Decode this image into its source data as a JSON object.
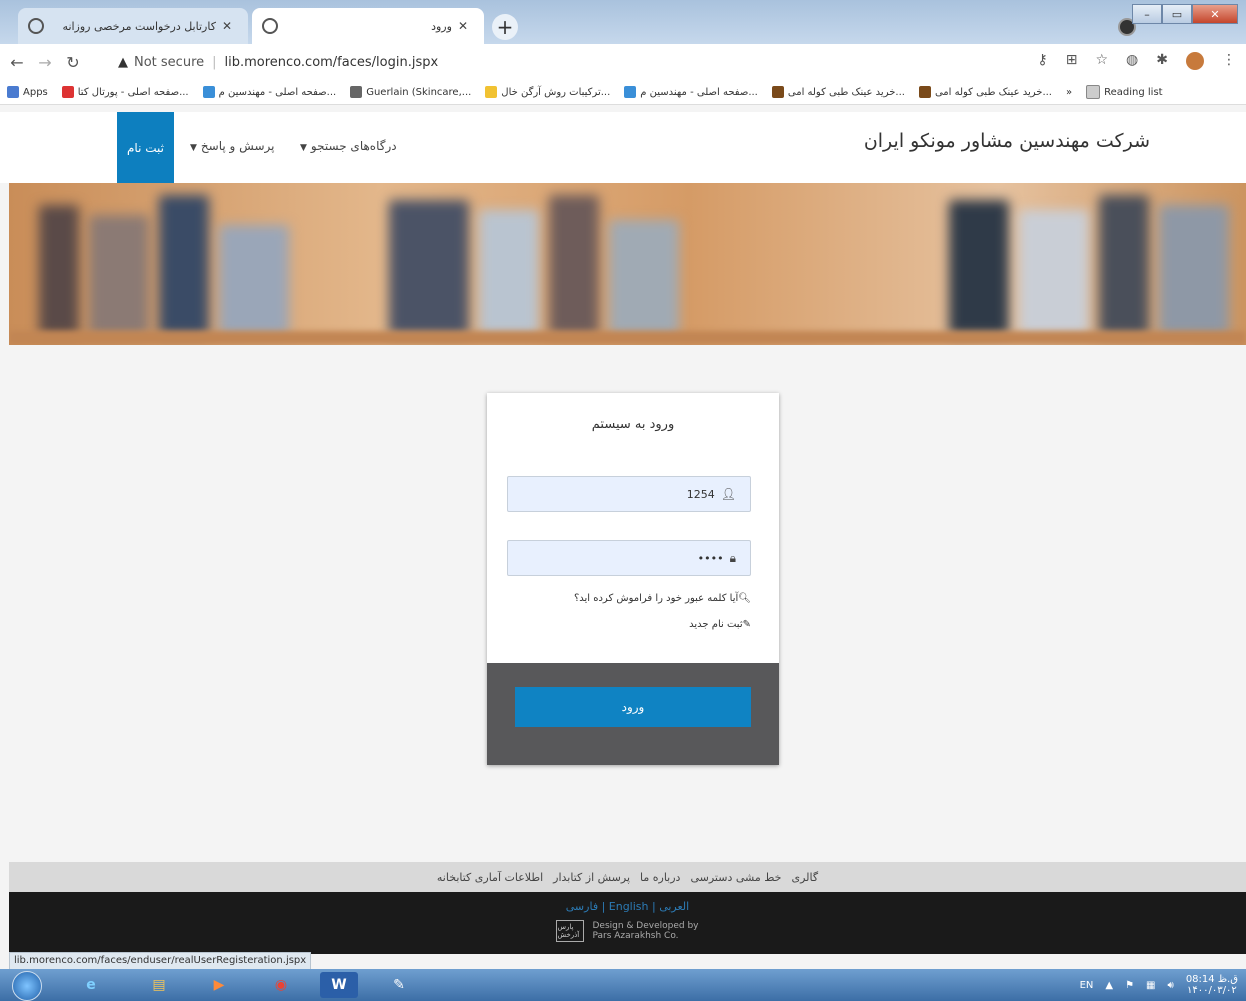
{
  "browser": {
    "tabs": [
      {
        "title": "کارتابل درخواست مرخصی روزانه",
        "active": false
      },
      {
        "title": "ورود",
        "active": true
      }
    ],
    "url_warning": "Not secure",
    "url": "lib.morenco.com/faces/login.jspx",
    "bookmarks": [
      {
        "label": "Apps",
        "icon": "apps-grid-icon"
      },
      {
        "label": "صفحه اصلی - پورتال کتا...",
        "icon": "red-bookmark-icon"
      },
      {
        "label": "صفحه اصلی - مهندسین م...",
        "icon": "blue-bookmark-icon"
      },
      {
        "label": "Guerlain (Skincare,...",
        "icon": "guerlain-icon"
      },
      {
        "label": "ترکیبات روش آرگن خال...",
        "icon": "yellow-bookmark-icon"
      },
      {
        "label": "صفحه اصلی - مهندسین م...",
        "icon": "blue-bookmark-icon"
      },
      {
        "label": "خرید عینک طبی کوله امی...",
        "icon": "glasses-icon"
      },
      {
        "label": "خرید عینک طبی کوله امی...",
        "icon": "glasses-icon"
      },
      {
        "label": "»",
        "icon": "overflow-icon"
      },
      {
        "label": "Reading list",
        "icon": "reading-list-icon"
      }
    ]
  },
  "site": {
    "title": "شرکت مهندسین مشاور مونکو ایران",
    "nav": {
      "register": "ثبت نام",
      "faq": "پرسش و پاسخ",
      "search_portals": "درگاه‌های جستجو"
    }
  },
  "login": {
    "title": "ورود به سیستم",
    "username_value": "1254",
    "password_value": "••••",
    "forgot_password": "آیا کلمه عبور خود را فراموش کرده اید؟",
    "new_register": "ثبت نام جدید",
    "submit": "ورود"
  },
  "footer": {
    "links": [
      "گالری",
      "خط مشی دسترسی",
      "درباره ما",
      "پرسش از کتابدار",
      "اطلاعات آماری کتابخانه"
    ],
    "languages": "فارسی | English | العربی",
    "credit_line1": "Design & Developed by",
    "credit_line2": "Pars Azarakhsh Co.",
    "logo_text": "پارس آذرخش"
  },
  "status_bar_url": "lib.morenco.com/faces/enduser/realUserRegisteration.jspx",
  "taskbar": {
    "lang": "EN",
    "time": "08:14 ق.ظ",
    "date": "۱۴۰۰/۰۳/۰۲"
  },
  "colors": {
    "accent": "#0d7fbf",
    "login_button": "#0f83c3",
    "card_footer": "#58585a",
    "footer_dark": "#1a1a1a"
  }
}
